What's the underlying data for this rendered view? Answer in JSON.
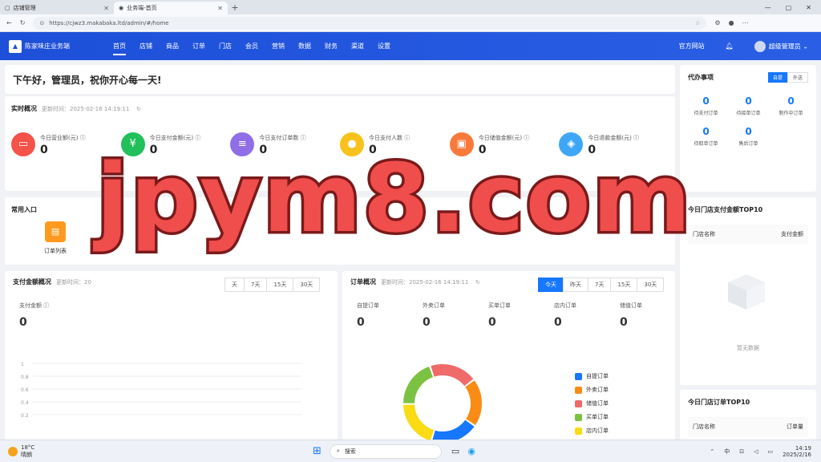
{
  "browser": {
    "tabs": [
      {
        "title": "店铺管理",
        "active": false
      },
      {
        "title": "业务端-首页",
        "active": true
      }
    ],
    "url": "https://cjwz3.makabaka.ltd/admin/#/home"
  },
  "nav": {
    "app_name": "陈家味庄业务端",
    "items": [
      "首页",
      "店铺",
      "商品",
      "订单",
      "门店",
      "会员",
      "营销",
      "数据",
      "财务",
      "渠道",
      "设置"
    ],
    "official_site": "官方网站",
    "user": "超级管理员"
  },
  "greeting": "下午好，管理员，祝你开心每一天!",
  "overview": {
    "title": "实时概况",
    "update_label": "更新时间：2025-02-16 14:19:11",
    "stats": [
      {
        "label": "今日营业额(元)",
        "value": "0",
        "color": "#f5524a",
        "icon": "shop-icon"
      },
      {
        "label": "今日支付金额(元)",
        "value": "0",
        "color": "#21c05a",
        "icon": "yuan-icon"
      },
      {
        "label": "今日支付订单数",
        "value": "0",
        "color": "#8f6ee8",
        "icon": "document-icon"
      },
      {
        "label": "今日支付人数",
        "value": "0",
        "color": "#f7c21b",
        "icon": "user-icon"
      },
      {
        "label": "今日储值金额(元)",
        "value": "0",
        "color": "#f77a3a",
        "icon": "wallet-icon"
      },
      {
        "label": "今日退款金额(元)",
        "value": "0",
        "color": "#3ea7f5",
        "icon": "shield-icon"
      }
    ]
  },
  "quick": {
    "title": "常用入口",
    "items": [
      {
        "label": "订单列表"
      }
    ]
  },
  "pay": {
    "title": "支付金额概况",
    "update_label": "更新时间：20",
    "ranges": [
      "天",
      "7天",
      "15天",
      "30天"
    ],
    "metric_label": "支付金额",
    "metric_value": "0"
  },
  "order": {
    "title": "订单概况",
    "update_label": "更新时间：2025-02-16 14:19:11",
    "ranges": [
      "今天",
      "昨天",
      "7天",
      "15天",
      "30天"
    ],
    "metrics": [
      {
        "label": "自提订单",
        "value": "0"
      },
      {
        "label": "外卖订单",
        "value": "0"
      },
      {
        "label": "买单订单",
        "value": "0"
      },
      {
        "label": "店内订单",
        "value": "0"
      },
      {
        "label": "储值订单",
        "value": "0"
      }
    ],
    "legend": [
      {
        "name": "自提订单",
        "color": "#1677ff"
      },
      {
        "name": "外卖订单",
        "color": "#fa8c16"
      },
      {
        "name": "储值订单",
        "color": "#f06a6a"
      },
      {
        "name": "买单订单",
        "color": "#7cc242"
      },
      {
        "name": "店内订单",
        "color": "#fadb14"
      }
    ]
  },
  "chart_data": {
    "type": "line",
    "ylim": [
      0,
      1
    ],
    "yticks": [
      "1",
      "0.8",
      "0.6",
      "0.4",
      "0.2"
    ],
    "series": []
  },
  "todo": {
    "title": "代办事项",
    "toggle": [
      "自提",
      "外送"
    ],
    "items": [
      {
        "label": "待支付订单",
        "value": "0"
      },
      {
        "label": "待接单订单",
        "value": "0"
      },
      {
        "label": "制作中订单",
        "value": "0"
      },
      {
        "label": "待取单订单",
        "value": "0"
      },
      {
        "label": "售后订单",
        "value": "0"
      }
    ]
  },
  "top10_pay": {
    "title": "今日门店支付金额TOP10",
    "col1": "门店名称",
    "col2": "支付金额",
    "empty": "暂无数据"
  },
  "top10_order": {
    "title": "今日门店订单TOP10",
    "col1": "门店名称",
    "col2": "订单量"
  },
  "taskbar": {
    "weather_temp": "18°C",
    "weather_text": "晴朗",
    "search": "搜索",
    "ime": "中",
    "time": "14:19",
    "date": "2025/2/16"
  },
  "watermark": "jpym8.com"
}
